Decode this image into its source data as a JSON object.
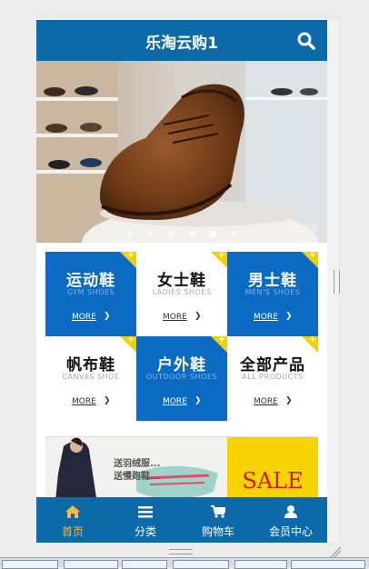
{
  "header": {
    "title": "乐淘云购1",
    "search_icon": "search-icon"
  },
  "banner": {
    "slides": 6,
    "active_slide": 5,
    "watermark": "大众点评"
  },
  "categories": [
    {
      "cn": "运动鞋",
      "en": "GYM SHOES",
      "more": "MORE",
      "style": "blue"
    },
    {
      "cn": "女士鞋",
      "en": "LADIES SHOES",
      "more": "MORE",
      "style": "white"
    },
    {
      "cn": "男士鞋",
      "en": "MEN'S SHOES",
      "more": "MORE",
      "style": "blue"
    },
    {
      "cn": "帆布鞋",
      "en": "CANVAS SHOE",
      "more": "MORE",
      "style": "white"
    },
    {
      "cn": "户外鞋",
      "en": "OUTDOOR SHOES",
      "more": "MORE",
      "style": "blue"
    },
    {
      "cn": "全部产品",
      "en": "ALL PRODUCTS",
      "more": "MORE",
      "style": "white"
    }
  ],
  "ad": {
    "line1": "送羽绒服...",
    "line2": "送慢跑鞋...",
    "sale": "SALE"
  },
  "tabbar": [
    {
      "label": "首页",
      "icon": "home-icon",
      "active": true
    },
    {
      "label": "分类",
      "icon": "list-icon",
      "active": false
    },
    {
      "label": "购物车",
      "icon": "cart-icon",
      "active": false
    },
    {
      "label": "会员中心",
      "icon": "user-icon",
      "active": false
    }
  ],
  "colors": {
    "primary": "#0b6aa7",
    "tile_blue": "#0b6ac2",
    "accent_yellow": "#f5d000",
    "active_tab": "#f7b84a"
  }
}
